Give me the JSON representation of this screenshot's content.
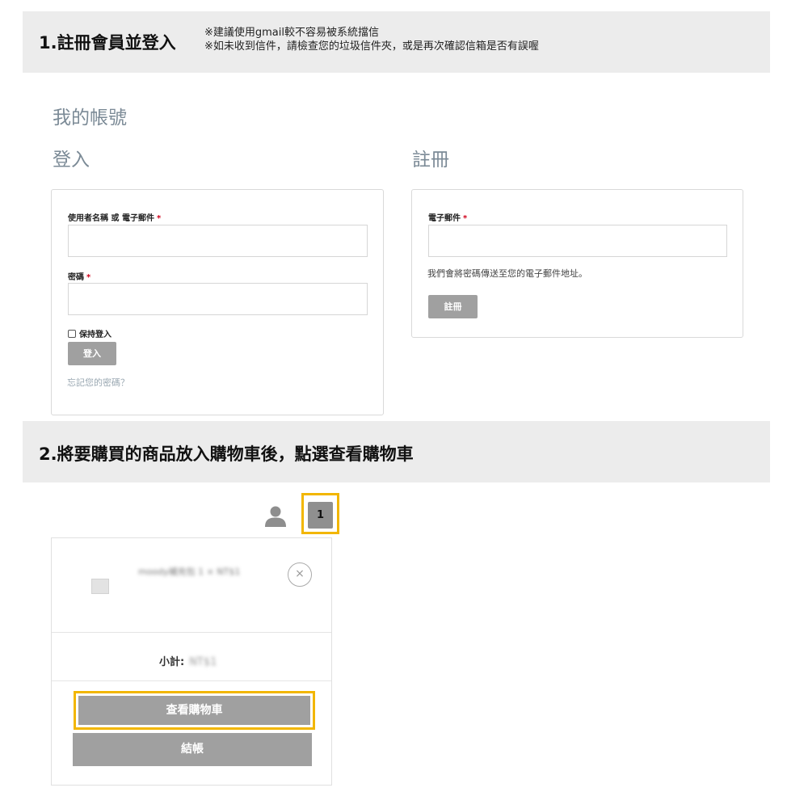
{
  "step1": {
    "title": "1.註冊會員並登入",
    "note1": "※建議使用gmail較不容易被系統擋信",
    "note2": "※如未收到信件，請檢查您的垃圾信件夾，或是再次確認信箱是否有誤喔"
  },
  "account": {
    "title": "我的帳號",
    "login": {
      "heading": "登入",
      "username_label": "使用者名稱 或 電子郵件",
      "password_label": "密碼",
      "required_mark": "*",
      "remember_label": "保持登入",
      "submit_label": "登入",
      "forgot_link": "忘記您的密碼？"
    },
    "register": {
      "heading": "註冊",
      "email_label": "電子郵件",
      "required_mark": "*",
      "note": "我們會將密碼傳送至您的電子郵件地址。",
      "submit_label": "註冊"
    }
  },
  "step2": {
    "title": "2.將要購買的商品放入購物車後，點選查看購物車"
  },
  "header_icons": {
    "user_icon": "user-icon",
    "cart_count": "1"
  },
  "cart_dropdown": {
    "item_text": "moody補充包 1 × NT$1",
    "remove_symbol": "×",
    "subtotal_label": "小計:",
    "subtotal_value": "NT$1",
    "view_cart_label": "查看購物車",
    "checkout_label": "結帳"
  },
  "colors": {
    "highlight": "#f2b600",
    "button": "#a0a0a0",
    "heading": "#7b8a96",
    "banner": "#ececec"
  }
}
